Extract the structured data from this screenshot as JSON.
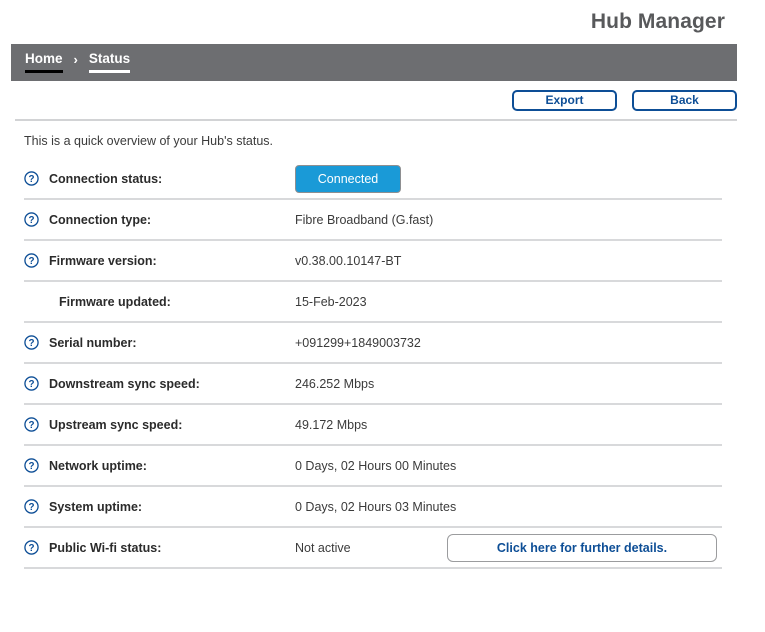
{
  "header": {
    "title": "Hub Manager"
  },
  "breadcrumb": {
    "home_label": "Home",
    "separator": "›",
    "current_label": "Status"
  },
  "toolbar": {
    "export_label": "Export",
    "back_label": "Back"
  },
  "main": {
    "intro_text": "This is a quick overview of your Hub's status.",
    "help_icon_name": "help-icon",
    "rows": [
      {
        "label": "Connection status:",
        "value": "Connected",
        "value_kind": "badge",
        "badge_color": "#1a9ad7",
        "has_help": true,
        "indented": false
      },
      {
        "label": "Connection type:",
        "value": "Fibre Broadband (G.fast)",
        "value_kind": "text",
        "has_help": true,
        "indented": false
      },
      {
        "label": "Firmware version:",
        "value": "v0.38.00.10147-BT",
        "value_kind": "text",
        "has_help": true,
        "indented": false
      },
      {
        "label": "Firmware updated:",
        "value": "15-Feb-2023",
        "value_kind": "text",
        "has_help": false,
        "indented": true
      },
      {
        "label": "Serial number:",
        "value": "+091299+1849003732",
        "value_kind": "text",
        "has_help": true,
        "indented": false
      },
      {
        "label": "Downstream sync speed:",
        "value": "246.252 Mbps",
        "value_kind": "text",
        "has_help": true,
        "indented": false
      },
      {
        "label": "Upstream sync speed:",
        "value": "49.172 Mbps",
        "value_kind": "text",
        "has_help": true,
        "indented": false
      },
      {
        "label": "Network uptime:",
        "value": "0 Days, 02 Hours 00 Minutes",
        "value_kind": "text",
        "has_help": true,
        "indented": false
      },
      {
        "label": "System uptime:",
        "value": "0 Days, 02 Hours 03 Minutes",
        "value_kind": "text",
        "has_help": true,
        "indented": false
      },
      {
        "label": "Public Wi-fi status:",
        "value": "Not active",
        "value_kind": "text",
        "has_help": true,
        "indented": false,
        "cta_label": "Click here for further details."
      }
    ]
  },
  "colors": {
    "brand_blue": "#0d4e96",
    "status_blue": "#1a9ad7",
    "bar_gray": "#6d6e71",
    "title_gray": "#58595b",
    "divider": "#d8d9db"
  }
}
